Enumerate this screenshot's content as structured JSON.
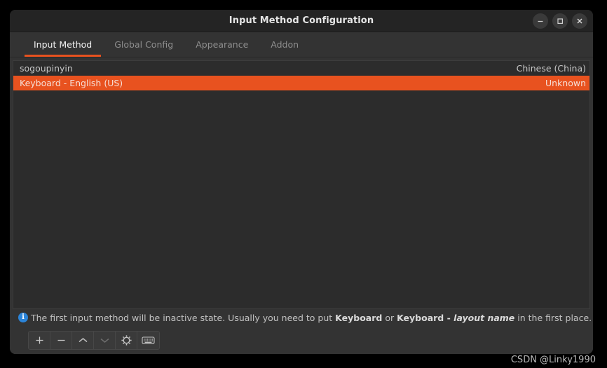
{
  "window": {
    "title": "Input Method Configuration",
    "controls": [
      {
        "name": "minimize-button",
        "icon": "minimize-icon",
        "label": "Minimize"
      },
      {
        "name": "maximize-button",
        "icon": "maximize-icon",
        "label": "Maximize"
      },
      {
        "name": "close-button",
        "icon": "close-icon",
        "label": "Close"
      }
    ]
  },
  "tabs": [
    {
      "label": "Input Method",
      "active": true
    },
    {
      "label": "Global Config",
      "active": false
    },
    {
      "label": "Appearance",
      "active": false
    },
    {
      "label": "Addon",
      "active": false
    }
  ],
  "input_methods": [
    {
      "name": "sogoupinyin",
      "language": "Chinese (China)",
      "selected": false
    },
    {
      "name": "Keyboard - English (US)",
      "language": "Unknown",
      "selected": true
    }
  ],
  "hint": {
    "icon": "info-icon",
    "icon_glyph": "i",
    "part1": "The first input method will be inactive state. Usually you need to put ",
    "bold1": "Keyboard",
    "part2": " or ",
    "bold2": "Keyboard - ",
    "italic1": "layout name",
    "part3": " in the first place."
  },
  "toolbar": [
    {
      "name": "add-input-method-button",
      "icon": "plus-icon",
      "label": "Add",
      "enabled": true
    },
    {
      "name": "remove-input-method-button",
      "icon": "minus-icon",
      "label": "Remove",
      "enabled": true
    },
    {
      "name": "move-up-button",
      "icon": "chevron-up-icon",
      "label": "Move Up",
      "enabled": true
    },
    {
      "name": "move-down-button",
      "icon": "chevron-down-icon",
      "label": "Move Down",
      "enabled": false
    },
    {
      "name": "configure-button",
      "icon": "gear-icon",
      "label": "Configure",
      "enabled": true
    },
    {
      "name": "keyboard-layout-button",
      "icon": "keyboard-icon",
      "label": "Keyboard Layout",
      "enabled": true
    }
  ],
  "watermark": "CSDN @Linky1990",
  "colors": {
    "accent": "#e8521f",
    "titlebar_bg": "#242424",
    "tabbar_bg": "#333333",
    "list_bg": "#2c2c2c",
    "info_blue": "#2b84d8"
  }
}
